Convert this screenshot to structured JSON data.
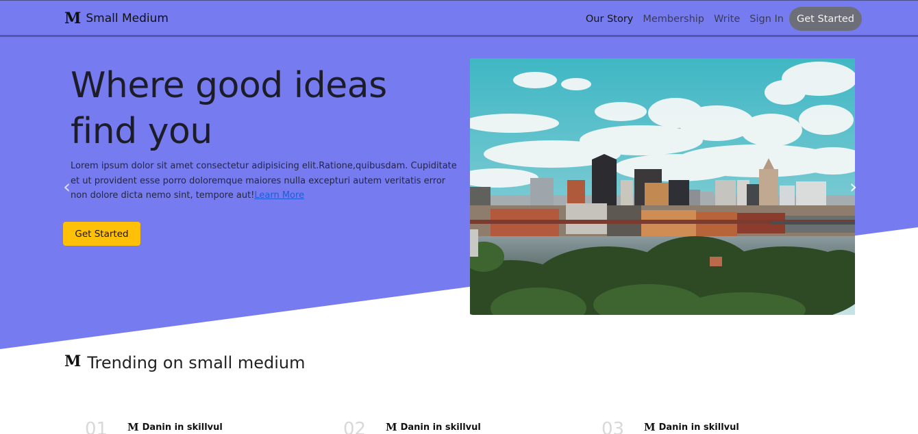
{
  "navbar": {
    "logo": "M",
    "brand": "Small Medium",
    "links": [
      "Our Story",
      "Membership",
      "Write",
      "Sign In"
    ],
    "cta": "Get Started"
  },
  "hero": {
    "title": "Where good ideas find you",
    "text": "Lorem ipsum dolor sit amet consectetur adipisicing elit.Ratione,quibusdam. Cupiditate et ut provident esse porro doloremque maiores nulla excepturi autem veritatis error non dolore dicta nemo sint, tempore aut!",
    "link": "Learn More",
    "button": "Get Started",
    "prev_icon": "‹",
    "next_icon": "›"
  },
  "trending": {
    "logo": "M",
    "title": "Trending on small medium",
    "items": [
      {
        "number": "01",
        "logo": "M",
        "author": "Danin in skillvul"
      },
      {
        "number": "02",
        "logo": "M",
        "author": "Danin in skillvul"
      },
      {
        "number": "03",
        "logo": "M",
        "author": "Danin in skillvul"
      }
    ]
  },
  "colors": {
    "hero_bg": "#767cf0",
    "accent_button": "#ffc107",
    "nav_cta": "#6c6f78"
  }
}
